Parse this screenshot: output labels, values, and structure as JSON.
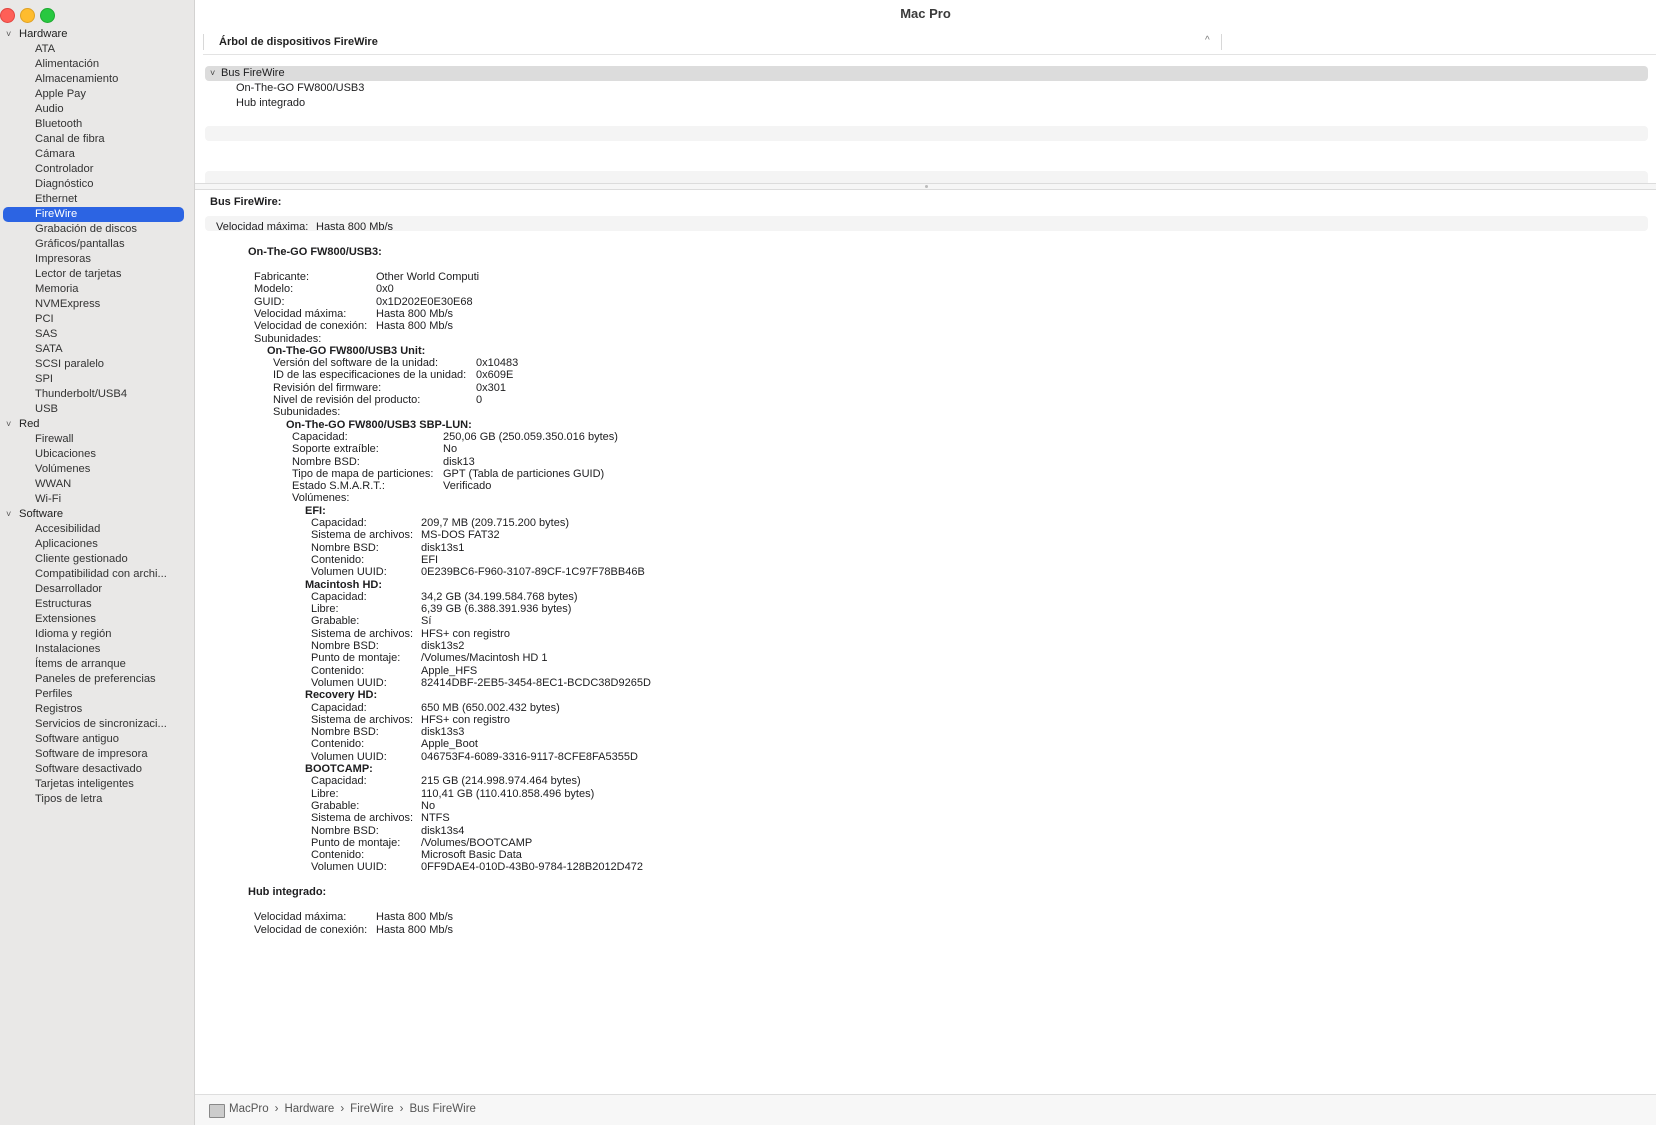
{
  "window": {
    "title": "Mac Pro"
  },
  "sidebar": {
    "groups": [
      {
        "label": "Hardware",
        "items": [
          "ATA",
          "Alimentación",
          "Almacenamiento",
          "Apple Pay",
          "Audio",
          "Bluetooth",
          "Canal de fibra",
          "Cámara",
          "Controlador",
          "Diagnóstico",
          "Ethernet",
          "FireWire",
          "Grabación de discos",
          "Gráficos/pantallas",
          "Impresoras",
          "Lector de tarjetas",
          "Memoria",
          "NVMExpress",
          "PCI",
          "SAS",
          "SATA",
          "SCSI paralelo",
          "SPI",
          "Thunderbolt/USB4",
          "USB"
        ]
      },
      {
        "label": "Red",
        "items": [
          "Firewall",
          "Ubicaciones",
          "Volúmenes",
          "WWAN",
          "Wi-Fi"
        ]
      },
      {
        "label": "Software",
        "items": [
          "Accesibilidad",
          "Aplicaciones",
          "Cliente gestionado",
          "Compatibilidad con archi...",
          "Desarrollador",
          "Estructuras",
          "Extensiones",
          "Idioma y región",
          "Instalaciones",
          "Ítems de arranque",
          "Paneles de preferencias",
          "Perfiles",
          "Registros",
          "Servicios de sincronizaci...",
          "Software antiguo",
          "Software de impresora",
          "Software desactivado",
          "Tarjetas inteligentes",
          "Tipos de letra"
        ]
      }
    ],
    "selected": "FireWire"
  },
  "tree_header": {
    "label": "Árbol de dispositivos FireWire"
  },
  "device_tree": [
    {
      "label": "Bus FireWire",
      "level": 0,
      "expanded": true,
      "selected": true
    },
    {
      "label": "On-The-GO FW800/USB3",
      "level": 1
    },
    {
      "label": "Hub integrado",
      "level": 1
    }
  ],
  "detail": [
    {
      "indent": 0,
      "bold": true,
      "label": "Bus FireWire:",
      "value": ""
    },
    {
      "indent": 1,
      "bold": false,
      "label": "Velocidad máxima:",
      "value": "Hasta 800 Mb/s"
    },
    {
      "indent": 2,
      "bold": true,
      "label": "On-The-GO FW800/USB3:",
      "value": ""
    },
    {
      "indent": 3,
      "bold": false,
      "label": "Fabricante:",
      "value": "Other World Computi"
    },
    {
      "indent": 3,
      "bold": false,
      "label": "Modelo:",
      "value": "0x0"
    },
    {
      "indent": 3,
      "bold": false,
      "label": "GUID:",
      "value": "0x1D202E0E30E68"
    },
    {
      "indent": 3,
      "bold": false,
      "label": "Velocidad máxima:",
      "value": "Hasta 800 Mb/s"
    },
    {
      "indent": 3,
      "bold": false,
      "label": "Velocidad de conexión:",
      "value": "Hasta 800 Mb/s"
    },
    {
      "indent": 3,
      "bold": false,
      "label": "Subunidades:",
      "value": ""
    },
    {
      "indent": 4,
      "bold": true,
      "label": "On-The-GO FW800/USB3 Unit:",
      "value": ""
    },
    {
      "indent": 5,
      "bold": false,
      "label": "Versión del software de la unidad:",
      "value": "0x10483"
    },
    {
      "indent": 5,
      "bold": false,
      "label": "ID de las especificaciones de la unidad:",
      "value": "0x609E"
    },
    {
      "indent": 5,
      "bold": false,
      "label": "Revisión del firmware:",
      "value": "0x301"
    },
    {
      "indent": 5,
      "bold": false,
      "label": "Nivel de revisión del producto:",
      "value": "0"
    },
    {
      "indent": 5,
      "bold": false,
      "label": "Subunidades:",
      "value": ""
    },
    {
      "indent": 6,
      "bold": true,
      "label": "On-The-GO FW800/USB3 SBP-LUN:",
      "value": ""
    },
    {
      "indent": 7,
      "bold": false,
      "label": "Capacidad:",
      "value": "250,06 GB (250.059.350.016 bytes)"
    },
    {
      "indent": 7,
      "bold": false,
      "label": "Soporte extraíble:",
      "value": "No"
    },
    {
      "indent": 7,
      "bold": false,
      "label": "Nombre BSD:",
      "value": "disk13"
    },
    {
      "indent": 7,
      "bold": false,
      "label": "Tipo de mapa de particiones:",
      "value": "GPT (Tabla de particiones GUID)"
    },
    {
      "indent": 7,
      "bold": false,
      "label": "Estado S.M.A.R.T.:",
      "value": "Verificado"
    },
    {
      "indent": 7,
      "bold": false,
      "label": "Volúmenes:",
      "value": ""
    },
    {
      "indent": 8,
      "bold": true,
      "label": "EFI:",
      "value": ""
    },
    {
      "indent": 9,
      "bold": false,
      "label": "Capacidad:",
      "value": "209,7 MB (209.715.200 bytes)"
    },
    {
      "indent": 9,
      "bold": false,
      "label": "Sistema de archivos:",
      "value": "MS-DOS FAT32"
    },
    {
      "indent": 9,
      "bold": false,
      "label": "Nombre BSD:",
      "value": "disk13s1"
    },
    {
      "indent": 9,
      "bold": false,
      "label": "Contenido:",
      "value": "EFI"
    },
    {
      "indent": 9,
      "bold": false,
      "label": "Volumen UUID:",
      "value": "0E239BC6-F960-3107-89CF-1C97F78BB46B"
    },
    {
      "indent": 8,
      "bold": true,
      "label": "Macintosh HD:",
      "value": ""
    },
    {
      "indent": 9,
      "bold": false,
      "label": "Capacidad:",
      "value": "34,2 GB (34.199.584.768 bytes)"
    },
    {
      "indent": 9,
      "bold": false,
      "label": "Libre:",
      "value": "6,39 GB (6.388.391.936 bytes)"
    },
    {
      "indent": 9,
      "bold": false,
      "label": "Grabable:",
      "value": "Sí"
    },
    {
      "indent": 9,
      "bold": false,
      "label": "Sistema de archivos:",
      "value": "HFS+ con registro"
    },
    {
      "indent": 9,
      "bold": false,
      "label": "Nombre BSD:",
      "value": "disk13s2"
    },
    {
      "indent": 9,
      "bold": false,
      "label": "Punto de montaje:",
      "value": "/Volumes/Macintosh HD 1"
    },
    {
      "indent": 9,
      "bold": false,
      "label": "Contenido:",
      "value": "Apple_HFS"
    },
    {
      "indent": 9,
      "bold": false,
      "label": "Volumen UUID:",
      "value": "82414DBF-2EB5-3454-8EC1-BCDC38D9265D"
    },
    {
      "indent": 8,
      "bold": true,
      "label": "Recovery HD:",
      "value": ""
    },
    {
      "indent": 9,
      "bold": false,
      "label": "Capacidad:",
      "value": "650 MB (650.002.432 bytes)"
    },
    {
      "indent": 9,
      "bold": false,
      "label": "Sistema de archivos:",
      "value": "HFS+ con registro"
    },
    {
      "indent": 9,
      "bold": false,
      "label": "Nombre BSD:",
      "value": "disk13s3"
    },
    {
      "indent": 9,
      "bold": false,
      "label": "Contenido:",
      "value": "Apple_Boot"
    },
    {
      "indent": 9,
      "bold": false,
      "label": "Volumen UUID:",
      "value": "046753F4-6089-3316-9117-8CFE8FA5355D"
    },
    {
      "indent": 8,
      "bold": true,
      "label": "BOOTCAMP:",
      "value": ""
    },
    {
      "indent": 9,
      "bold": false,
      "label": "Capacidad:",
      "value": "215 GB (214.998.974.464 bytes)"
    },
    {
      "indent": 9,
      "bold": false,
      "label": "Libre:",
      "value": "110,41 GB (110.410.858.496 bytes)"
    },
    {
      "indent": 9,
      "bold": false,
      "label": "Grabable:",
      "value": "No"
    },
    {
      "indent": 9,
      "bold": false,
      "label": "Sistema de archivos:",
      "value": "NTFS"
    },
    {
      "indent": 9,
      "bold": false,
      "label": "Nombre BSD:",
      "value": "disk13s4"
    },
    {
      "indent": 9,
      "bold": false,
      "label": "Punto de montaje:",
      "value": "/Volumes/BOOTCAMP"
    },
    {
      "indent": 9,
      "bold": false,
      "label": "Contenido:",
      "value": "Microsoft Basic Data"
    },
    {
      "indent": 9,
      "bold": false,
      "label": "Volumen UUID:",
      "value": "0FF9DAE4-010D-43B0-9784-128B2012D472"
    },
    {
      "indent": 2,
      "bold": true,
      "label": "Hub integrado:",
      "value": ""
    },
    {
      "indent": 3,
      "bold": false,
      "label": "Velocidad máxima:",
      "value": "Hasta 800 Mb/s"
    },
    {
      "indent": 3,
      "bold": false,
      "label": "Velocidad de conexión:",
      "value": "Hasta 800 Mb/s"
    }
  ],
  "status_bar": {
    "icon": "mac-icon",
    "crumbs": [
      "MacPro",
      "Hardware",
      "FireWire",
      "Bus FireWire"
    ],
    "separator": "›"
  },
  "colors": {
    "selection": "#2c64e3",
    "sidebar_bg": "#e9e8e7"
  }
}
